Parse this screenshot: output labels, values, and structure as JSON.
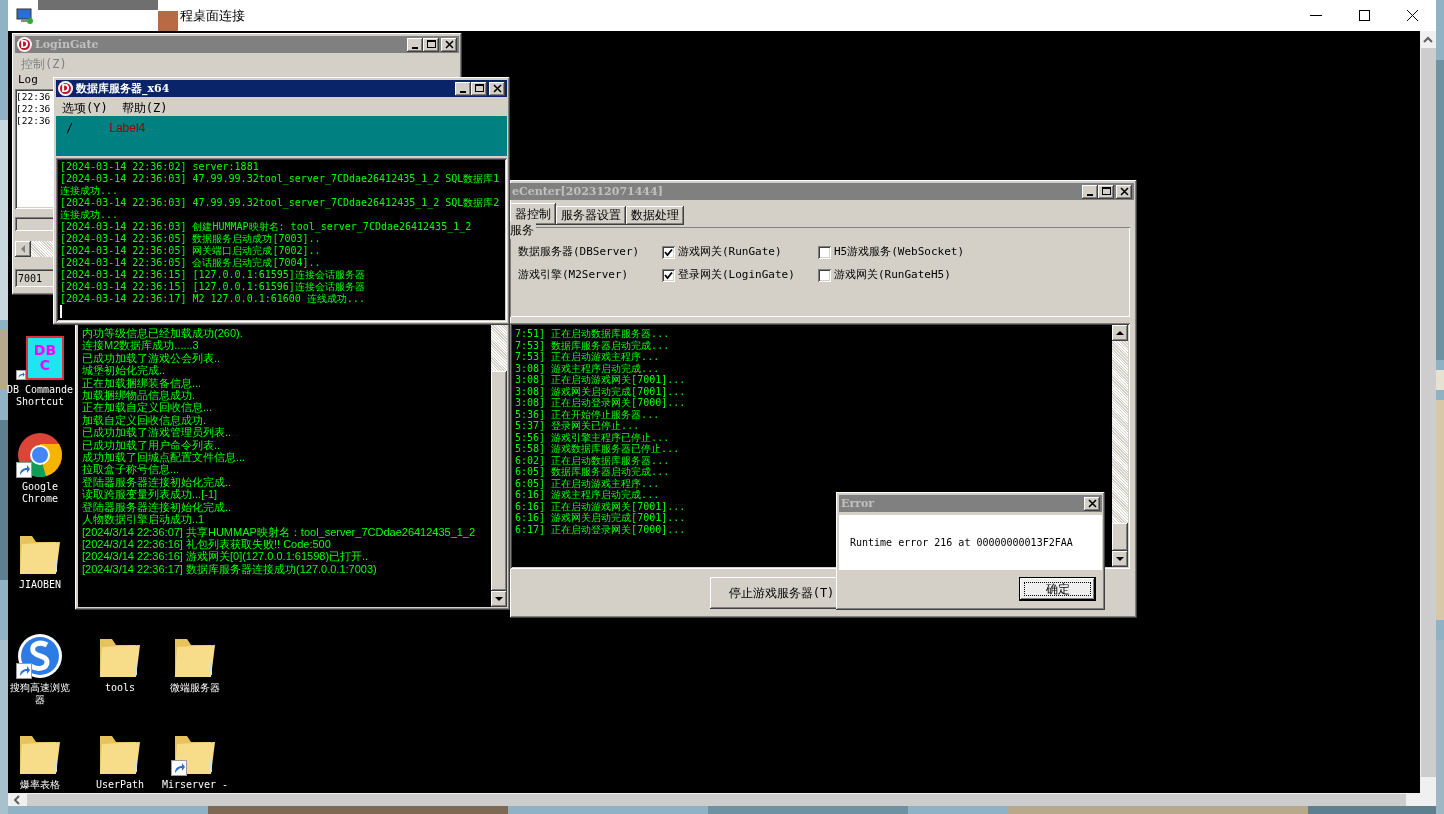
{
  "remote_window": {
    "title": "程桌面连接"
  },
  "login_gate": {
    "logo": "D",
    "title": "LoginGate",
    "active": false,
    "menu": [
      {
        "label": "控制(Z)",
        "disabled": true
      }
    ],
    "group_label": "Log",
    "log": [
      "[22:36",
      "[22:36",
      "[22:36"
    ],
    "port": "7001"
  },
  "db_server": {
    "logo": "D",
    "title": "数据库服务器_x64",
    "active": true,
    "menu": [
      {
        "label": "选项(Y)",
        "disabled": false
      },
      {
        "label": "帮助(Z)",
        "disabled": false
      }
    ],
    "status": {
      "indicator": "/",
      "label": "Label4"
    },
    "log": [
      "[2024-03-14 22:36:02] server:1881",
      "[2024-03-14 22:36:03] 47.99.99.32tool_server_7CDdae26412435_1_2 SQL数据库1连接成功...",
      "[2024-03-14 22:36:03] 47.99.99.32tool_server_7CDdae26412435_1_2 SQL数据库2连接成功...",
      "[2024-03-14 22:36:03] 创建HUMMAP映射名: tool_server_7CDdae26412435_1_2",
      "[2024-03-14 22:36:05] 数据服务启动成功[7003]..",
      "[2024-03-14 22:36:05] 网关端口启动完成[7002]..",
      "[2024-03-14 22:36:05] 会话服务启动完成[7004]..",
      "[2024-03-14 22:36:15] [127.0.0.1:61595]连接会话服务器",
      "[2024-03-14 22:36:15] [127.0.0.1:61596]连接会话服务器",
      "[2024-03-14 22:36:17] M2 127.0.0.1:61600 连线成功..."
    ]
  },
  "m2_console": {
    "log": [
      "内功等级信息已经加载成功(260).",
      "连接M2数据库成功......3",
      "已成功加载了游戏公会列表..",
      "城堡初始化完成..",
      "正在加载捆绑装备信息...",
      "加载捆绑物品信息成功.",
      "正在加载自定义回收信息...",
      "加载自定义回收信息成功.",
      "已成功加载了游戏管理员列表..",
      "已成功加载了用户命令列表..",
      "成功加载了回城点配置文件信息...",
      "拉取盒子称号信息...",
      "登陆器服务器连接初始化完成..",
      "读取跨服变量列表成功...[-1]",
      "登陆器服务器连接初始化完成..",
      "人物数据引擎启动成功..1",
      "[2024/3/14 22:36:07] 共享HUMMAP映射名：tool_server_7CDdae26412435_1_2",
      "[2024/3/14 22:36:16] 礼包列表获取失败!! Code:500",
      "[2024/3/14 22:36:16] 游戏网关[0](127.0.0.1:61598)已打开..",
      "[2024/3/14 22:36:17] 数据库服务器连接成功(127.0.0.1:7003)"
    ]
  },
  "game_center": {
    "title": "eCenter[202312071444]",
    "active": false,
    "tabs": [
      {
        "label": "器控制",
        "selected": true
      },
      {
        "label": "服务器设置",
        "selected": false
      },
      {
        "label": "数据处理",
        "selected": false
      }
    ],
    "group_label": "服务",
    "services": [
      {
        "kind": "text",
        "label": "数据服务器(DBServer)"
      },
      {
        "kind": "checkbox",
        "label": "游戏网关(RunGate)",
        "checked": true
      },
      {
        "kind": "checkbox",
        "label": "H5游戏服务(WebSocket)",
        "checked": false
      },
      {
        "kind": "text",
        "label": "游戏引擎(M2Server)"
      },
      {
        "kind": "checkbox",
        "label": "登录网关(LoginGate)",
        "checked": true
      },
      {
        "kind": "checkbox",
        "label": "游戏网关(RunGateH5)",
        "checked": false
      }
    ],
    "log": [
      "7:51] 正在启动数据库服务器...",
      "7:53] 数据库服务器启动完成...",
      "7:53] 正在启动游戏主程序...",
      "3:08] 游戏主程序启动完成...",
      "3:08] 正在启动游戏网关[7001]...",
      "3:08] 游戏网关启动完成[7001]...",
      "3:08] 正在启动登录网关[7000]...",
      "5:36] 正在开始停止服务器...",
      "5:37] 登录网关已停止...",
      "5:56] 游戏引擎主程序已停止...",
      "5:58] 游戏数据库服务器已停止...",
      "6:02] 正在启动数据库服务器...",
      "6:05] 数据库服务器启动完成...",
      "6:05] 正在启动游戏主程序...",
      "6:16] 游戏主程序启动完成...",
      "6:16] 正在启动游戏网关[7001]...",
      "6:16] 游戏网关启动完成[7001]...",
      "6:17] 正在启动登录网关[7000]..."
    ],
    "button": "停止游戏服务器(T)"
  },
  "error_dialog": {
    "title": "Error",
    "active": false,
    "message": "Runtime error 216 at 00000000013F2FAA",
    "button": "确定"
  },
  "desktop_icons": [
    {
      "kind": "dbc",
      "badge": "DBC",
      "lines": [
        "DB Commande",
        "Shortcut"
      ],
      "shortcut": true
    },
    {
      "kind": "chrome",
      "lines": [
        "Google",
        "Chrome"
      ],
      "shortcut": true
    },
    {
      "kind": "folder",
      "lines": [
        "JIAOBEN"
      ],
      "shortcut": false
    },
    {
      "kind": "sogou",
      "lines": [
        "搜狗高速浏览",
        "器"
      ],
      "shortcut": true
    },
    {
      "kind": "folder",
      "lines": [
        "tools"
      ],
      "shortcut": false
    },
    {
      "kind": "folder",
      "lines": [
        "微端服务器"
      ],
      "shortcut": false
    },
    {
      "kind": "folder",
      "lines": [
        "爆率表格"
      ],
      "shortcut": false
    },
    {
      "kind": "folder",
      "lines": [
        "UserPath"
      ],
      "shortcut": false
    },
    {
      "kind": "folder",
      "lines": [
        "Mirserver -"
      ],
      "shortcut": true
    }
  ]
}
